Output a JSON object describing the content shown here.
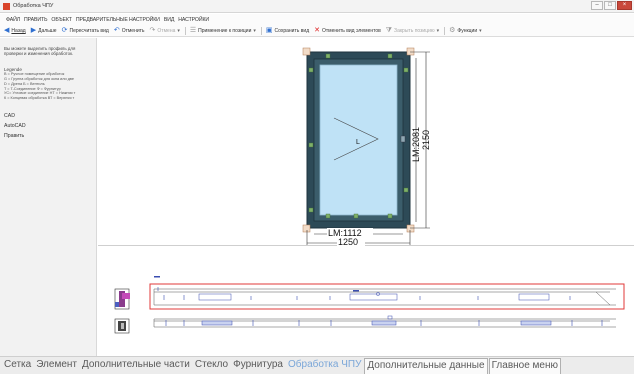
{
  "window": {
    "title": "Обработка ЧПУ",
    "controls": {
      "minimize": "–",
      "maximize": "□",
      "close": "×"
    }
  },
  "menu": {
    "items": [
      "ФАЙЛ",
      "ПРАВИТЬ",
      "ОБЪЕКТ",
      "ПРЕДВАРИТЕЛЬНЫЕ НАСТРОЙКИ",
      "ВИД",
      "НАСТРОЙКИ"
    ]
  },
  "toolbar": {
    "back": "Назад",
    "forward": "Дальше",
    "recalc": "Пересчитать вид",
    "undo": "Отменить",
    "redo": "Отмена",
    "apply_to_position": "Применение к позиции",
    "save_view": "Сохранить вид",
    "cancel_element_view": "Отменить вид элементов",
    "close_position": "Закрыть позицию",
    "functions": "Функции",
    "dropdown_glyph": "▾"
  },
  "sidebar": {
    "hint_lines": [
      "Вы можете выделить профиль для",
      "проверки и изменения обработок."
    ],
    "legend_title": "Legende",
    "legend_rows": [
      "B = Ручное помещение обработок",
      "G = Группа обработок для окна или две",
      "D = Дрена            Б = Вентиль",
      "T = T-Соединение     Ф = Фурнитур",
      "УС= Угловое соединение  НТ = Нижняя т",
      "К  = Концевая обработка  ВТ = Верхняя т"
    ],
    "links": [
      "CAD",
      "AutoCAD",
      "Править"
    ]
  },
  "drawing": {
    "opening_label": "L",
    "height_lm": "LM:2081",
    "height_total": "2150",
    "width_lm": "LM:1112",
    "width_total": "1250",
    "frame_color": "#2d4a57",
    "glass_color": "#bfe2f6",
    "highlight_color": "#e03a3a"
  },
  "tabs": {
    "items": [
      {
        "label": "Сетка",
        "active": false
      },
      {
        "label": "Элемент",
        "active": false
      },
      {
        "label": "Дополнительные части",
        "active": false
      },
      {
        "label": "Стекло",
        "active": false
      },
      {
        "label": "Фурнитура",
        "active": false
      },
      {
        "label": "Обработка ЧПУ",
        "active": true
      },
      {
        "label": "Дополнительные данные",
        "active": false
      },
      {
        "label": "Главное меню",
        "active": false
      }
    ]
  }
}
